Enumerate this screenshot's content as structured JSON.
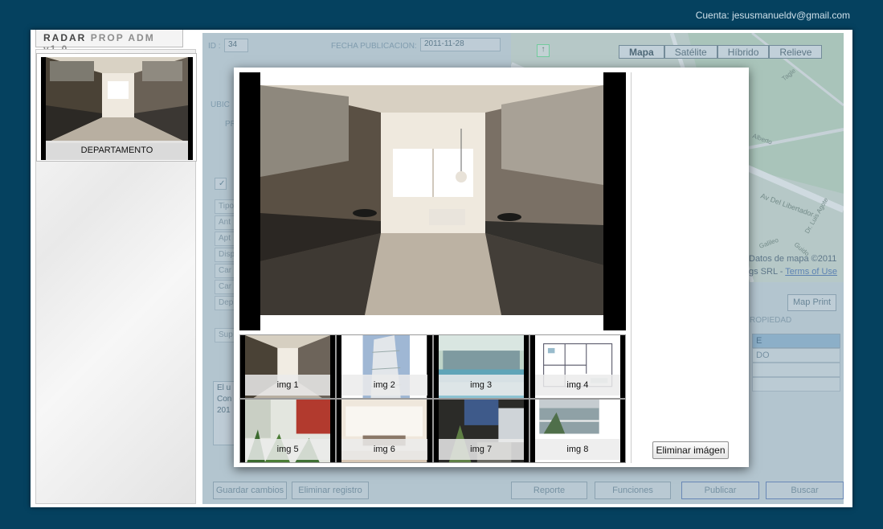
{
  "account": {
    "text": "Cuenta: jesusmanueldv@gmail.com"
  },
  "app": {
    "title_a": "RADAR",
    "title_b": "PROP ADM",
    "title_c": "v1.0"
  },
  "sidebar": {
    "items": [
      {
        "caption": "DEPARTAMENTO"
      }
    ]
  },
  "form": {
    "id_label": "ID :",
    "id_value": "34",
    "fecha_label": "FECHA PUBLICACION:",
    "fecha_value": "2011-11-28",
    "ubic_label": "UBIC",
    "pr_label": "PR",
    "rows": [
      "Tipo",
      "Ant",
      "Apt",
      "Disp",
      "Car",
      "Car",
      "Dep",
      "Sup"
    ],
    "desc_lines": [
      "El u",
      "Con",
      "201"
    ]
  },
  "map": {
    "types": [
      "Mapa",
      "Satélite",
      "Híbrido",
      "Relieve"
    ],
    "streets": [
      "Av Del Libertador",
      "Tagle",
      "Alberto",
      "Galileo",
      "Guido",
      "Dr. Luis Agote"
    ],
    "attribution": "Datos de mapa ©2011",
    "attribution2": "gs SRL - ",
    "terms": "Terms of Use",
    "print_button": "Map Print",
    "propiedad_label": "ROPIEDAD",
    "table_cells": [
      "E",
      "DO"
    ]
  },
  "bottom_buttons": {
    "save": "Guardar cambios",
    "delete": "Eliminar registro",
    "report": "Reporte",
    "functions": "Funciones",
    "publish": "Publicar",
    "search": "Buscar"
  },
  "modal": {
    "thumbnails": [
      {
        "label": "img 1",
        "scene": "kitchen"
      },
      {
        "label": "img 2",
        "scene": "tower"
      },
      {
        "label": "img 3",
        "scene": "pool"
      },
      {
        "label": "img 4",
        "scene": "floorplan"
      },
      {
        "label": "img 5",
        "scene": "garden"
      },
      {
        "label": "img 6",
        "scene": "living"
      },
      {
        "label": "img 7",
        "scene": "courtyard"
      },
      {
        "label": "img 8",
        "scene": "balcony"
      }
    ],
    "delete_image": "Eliminar imágen"
  }
}
